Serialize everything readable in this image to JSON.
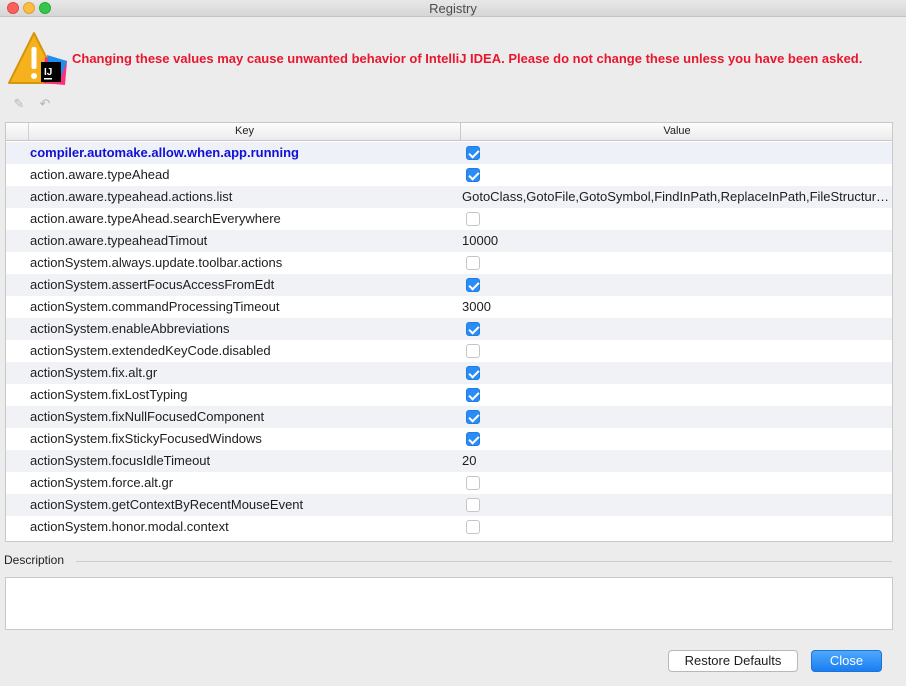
{
  "window": {
    "title": "Registry"
  },
  "warning": {
    "text": "Changing these values may cause unwanted behavior of IntelliJ IDEA. Please do not change these unless you have been asked.",
    "color": "#e8162e"
  },
  "toolbar": {
    "edit_icon": "pencil-icon",
    "revert_icon": "undo-icon"
  },
  "table": {
    "columns": {
      "key": "Key",
      "value": "Value"
    },
    "rows": [
      {
        "key": "compiler.automake.allow.when.app.running",
        "type": "bool",
        "value": true,
        "modified": true
      },
      {
        "key": "action.aware.typeAhead",
        "type": "bool",
        "value": true
      },
      {
        "key": "action.aware.typeahead.actions.list",
        "type": "text",
        "value": "GotoClass,GotoFile,GotoSymbol,FindInPath,ReplaceInPath,FileStructurePopup"
      },
      {
        "key": "action.aware.typeAhead.searchEverywhere",
        "type": "bool",
        "value": false
      },
      {
        "key": "action.aware.typeaheadTimout",
        "type": "text",
        "value": "10000"
      },
      {
        "key": "actionSystem.always.update.toolbar.actions",
        "type": "bool",
        "value": false
      },
      {
        "key": "actionSystem.assertFocusAccessFromEdt",
        "type": "bool",
        "value": true
      },
      {
        "key": "actionSystem.commandProcessingTimeout",
        "type": "text",
        "value": "3000"
      },
      {
        "key": "actionSystem.enableAbbreviations",
        "type": "bool",
        "value": true
      },
      {
        "key": "actionSystem.extendedKeyCode.disabled",
        "type": "bool",
        "value": false
      },
      {
        "key": "actionSystem.fix.alt.gr",
        "type": "bool",
        "value": true
      },
      {
        "key": "actionSystem.fixLostTyping",
        "type": "bool",
        "value": true
      },
      {
        "key": "actionSystem.fixNullFocusedComponent",
        "type": "bool",
        "value": true
      },
      {
        "key": "actionSystem.fixStickyFocusedWindows",
        "type": "bool",
        "value": true
      },
      {
        "key": "actionSystem.focusIdleTimeout",
        "type": "text",
        "value": "20"
      },
      {
        "key": "actionSystem.force.alt.gr",
        "type": "bool",
        "value": false
      },
      {
        "key": "actionSystem.getContextByRecentMouseEvent",
        "type": "bool",
        "value": false
      },
      {
        "key": "actionSystem.honor.modal.context",
        "type": "bool",
        "value": false
      }
    ]
  },
  "description": {
    "label": "Description",
    "value": ""
  },
  "buttons": {
    "restore": "Restore Defaults",
    "close": "Close"
  },
  "colors": {
    "checkbox_on": "#2a8cf5",
    "modified_key": "#1010d6",
    "primary_button": "#1a7ef2"
  }
}
